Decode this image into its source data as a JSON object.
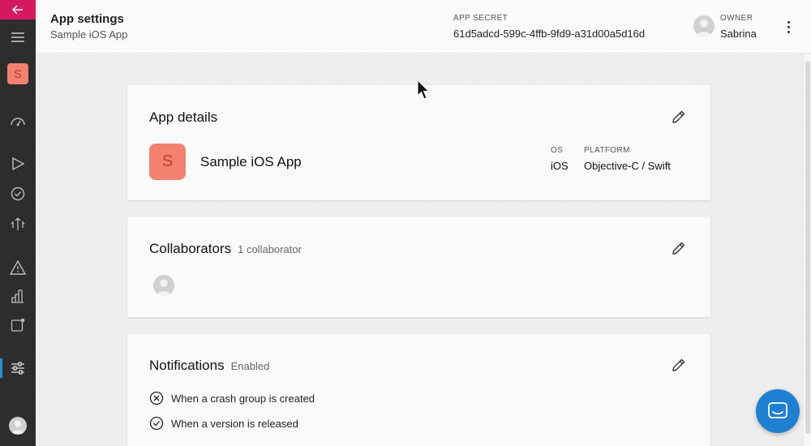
{
  "rail": {
    "app_initial": "S",
    "icons": [
      "back-arrow-icon",
      "hamburger-menu-icon",
      "dashboard-gauge-icon",
      "play-build-icon",
      "check-circle-icon",
      "distribute-icon",
      "warning-icon",
      "analytics-bars-icon",
      "push-notification-icon",
      "settings-sliders-icon",
      "user-avatar-icon"
    ],
    "accent": "#d6195f",
    "active_indicator": "#2e90d1"
  },
  "header": {
    "title": "App settings",
    "subtitle": "Sample iOS App",
    "secret_label": "APP SECRET",
    "secret_value": "61d5adcd-599c-4ffb-9fd9-a31d00a5d16d",
    "owner_label": "OWNER",
    "owner_name": "Sabrina"
  },
  "app_details": {
    "heading": "App details",
    "app_initial": "S",
    "app_name": "Sample iOS App",
    "os_label": "OS",
    "os_value": "iOS",
    "platform_label": "PLATFORM",
    "platform_value": "Objective-C / Swift"
  },
  "collaborators": {
    "heading": "Collaborators",
    "count_text": "1 collaborator"
  },
  "notifications": {
    "heading": "Notifications",
    "status": "Enabled",
    "items": [
      {
        "label": "When a crash group is created",
        "icon": "x-circle-icon"
      },
      {
        "label": "When a version is released",
        "icon": "check-circle-icon"
      }
    ]
  },
  "colors": {
    "app_tile": "#f2826f",
    "fab": "#1f7fd0"
  }
}
